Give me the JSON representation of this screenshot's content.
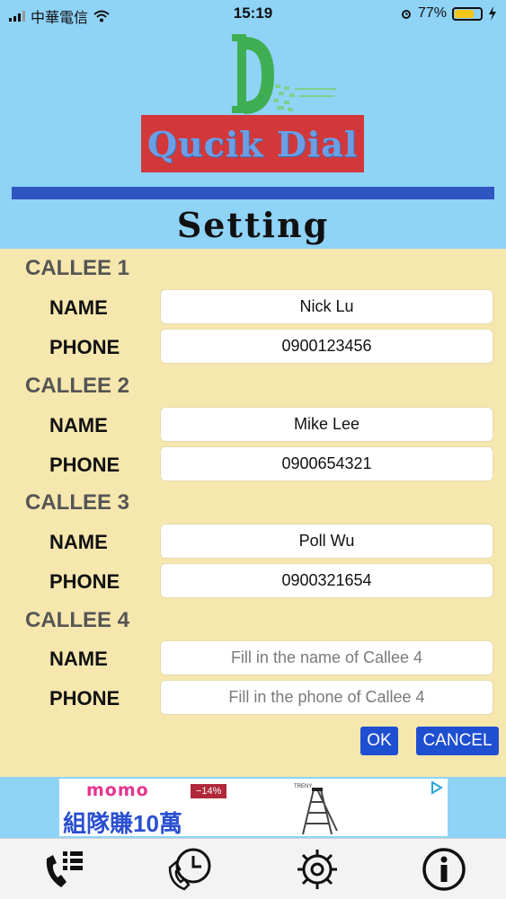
{
  "status_bar": {
    "carrier": "中華電信",
    "time": "15:19",
    "battery": "77%",
    "battery_level": 0.77
  },
  "header": {
    "logo_text": "Qucik Dial",
    "title": "Setting"
  },
  "labels": {
    "name": "NAME",
    "phone": "PHONE"
  },
  "callees": [
    {
      "heading": "CALLEE 1",
      "name_value": "Nick Lu",
      "phone_value": "0900123456"
    },
    {
      "heading": "CALLEE 2",
      "name_value": "Mike Lee",
      "phone_value": "0900654321"
    },
    {
      "heading": "CALLEE 3",
      "name_value": "Poll Wu",
      "phone_value": "0900321654"
    },
    {
      "heading": "CALLEE 4",
      "name_placeholder": "Fill in the name of Callee 4",
      "phone_placeholder": "Fill in the phone of Callee 4"
    }
  ],
  "buttons": {
    "ok": "OK",
    "cancel": "CANCEL"
  },
  "ad": {
    "brand": "momo",
    "discount": "−14%",
    "slogan": "組隊賺10萬",
    "product_brand": "TRENY"
  },
  "tabs": [
    {
      "icon": "phone-list-icon"
    },
    {
      "icon": "history-icon"
    },
    {
      "icon": "gear-icon"
    },
    {
      "icon": "info-icon"
    }
  ],
  "colors": {
    "header_bg": "#8fd3f7",
    "panel_bg": "#f6e7ae",
    "button_bg": "#1f4fd1",
    "banner_red": "#d2383a"
  }
}
